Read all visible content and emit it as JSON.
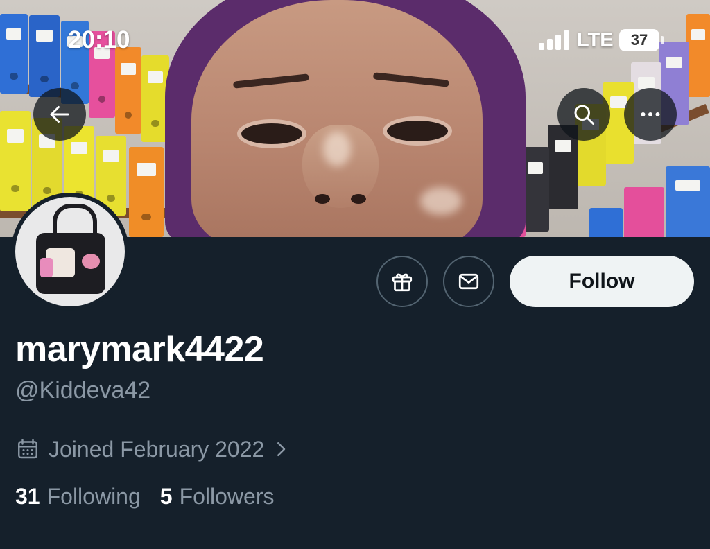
{
  "status_bar": {
    "time": "20:10",
    "network": "LTE",
    "battery": "37"
  },
  "header": {
    "back_icon": "arrow-left-icon",
    "search_icon": "search-icon",
    "more_icon": "more-horizontal-icon"
  },
  "actions": {
    "gift_icon": "gift-icon",
    "message_icon": "envelope-icon",
    "follow_label": "Follow"
  },
  "profile": {
    "display_name": "marymark4422",
    "handle": "@Kiddeva42",
    "joined": "Joined February 2022",
    "following_count": "31",
    "following_label": "Following",
    "followers_count": "5",
    "followers_label": "Followers"
  },
  "colors": {
    "background": "#15202b",
    "secondary_text": "#8b98a5",
    "follow_button_bg": "#eff3f4",
    "button_border": "#536471"
  }
}
